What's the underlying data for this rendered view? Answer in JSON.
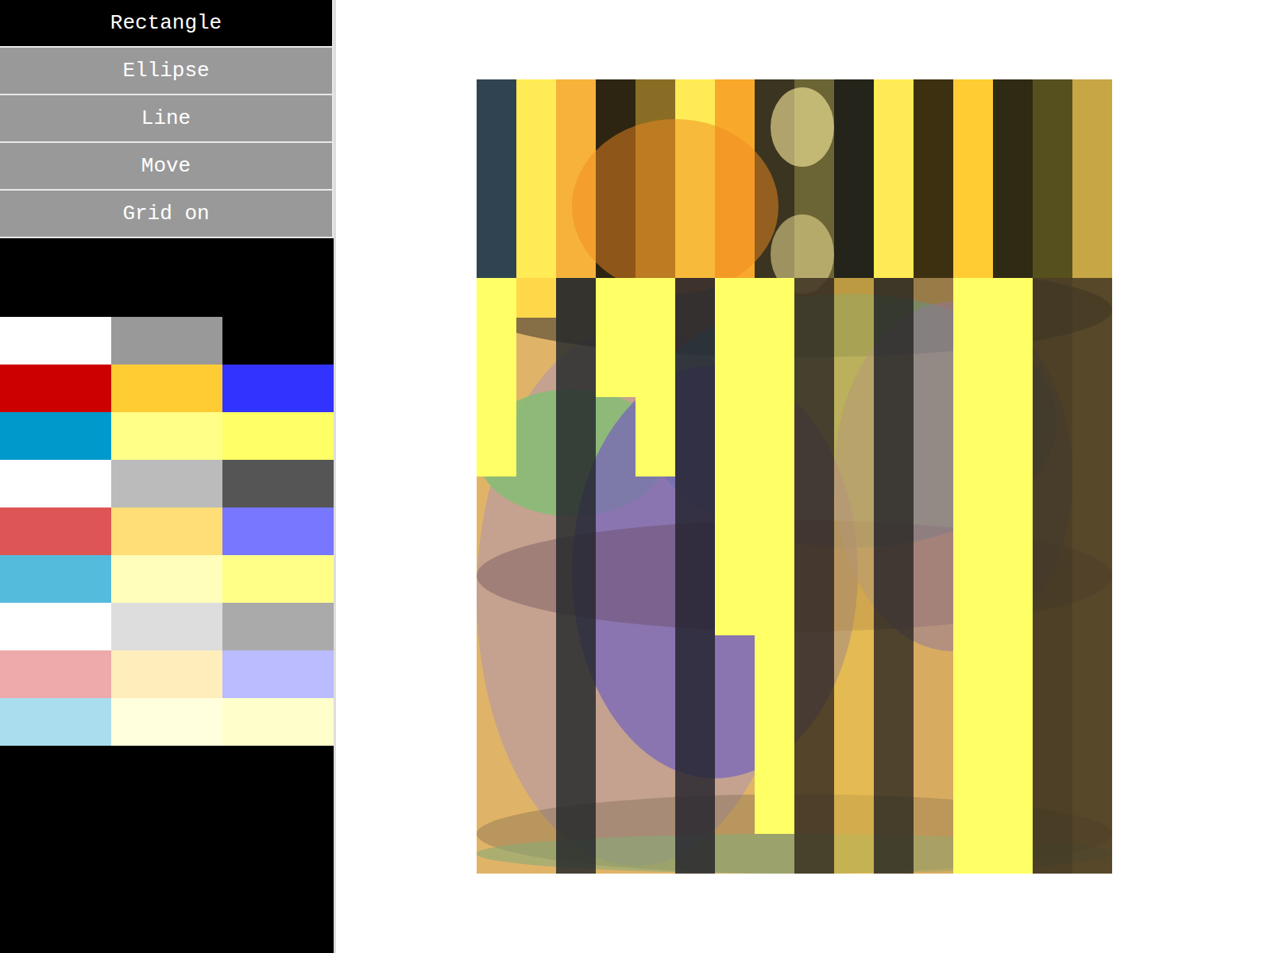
{
  "toolbar": [
    {
      "label": "Rectangle",
      "selected": true
    },
    {
      "label": "Ellipse",
      "selected": false
    },
    {
      "label": "Line",
      "selected": false
    },
    {
      "label": "Move",
      "selected": false
    },
    {
      "label": "Grid on",
      "selected": false
    }
  ],
  "palette": [
    {
      "color": "#ffffff"
    },
    {
      "color": "#999999"
    },
    {
      "color": "#000000"
    },
    {
      "color": "#cc0000"
    },
    {
      "color": "#ffcc33"
    },
    {
      "color": "#3333ff"
    },
    {
      "color": "#0099cc"
    },
    {
      "color": "#ffff88"
    },
    {
      "color": "#ffff66"
    },
    {
      "color": "#ffffff"
    },
    {
      "color": "#bbbbbb"
    },
    {
      "color": "#555555"
    },
    {
      "color": "#dd5555"
    },
    {
      "color": "#ffdd77"
    },
    {
      "color": "#7777ff"
    },
    {
      "color": "#55bbdd"
    },
    {
      "color": "#ffffbb"
    },
    {
      "color": "#ffff88"
    },
    {
      "color": "#ffffff"
    },
    {
      "color": "#dddddd"
    },
    {
      "color": "#aaaaaa"
    },
    {
      "color": "#eeaaaa"
    },
    {
      "color": "#ffeebb"
    },
    {
      "color": "#bbbbff"
    },
    {
      "color": "#aaddee"
    },
    {
      "color": "#ffffdd"
    },
    {
      "color": "#ffffcc"
    }
  ]
}
